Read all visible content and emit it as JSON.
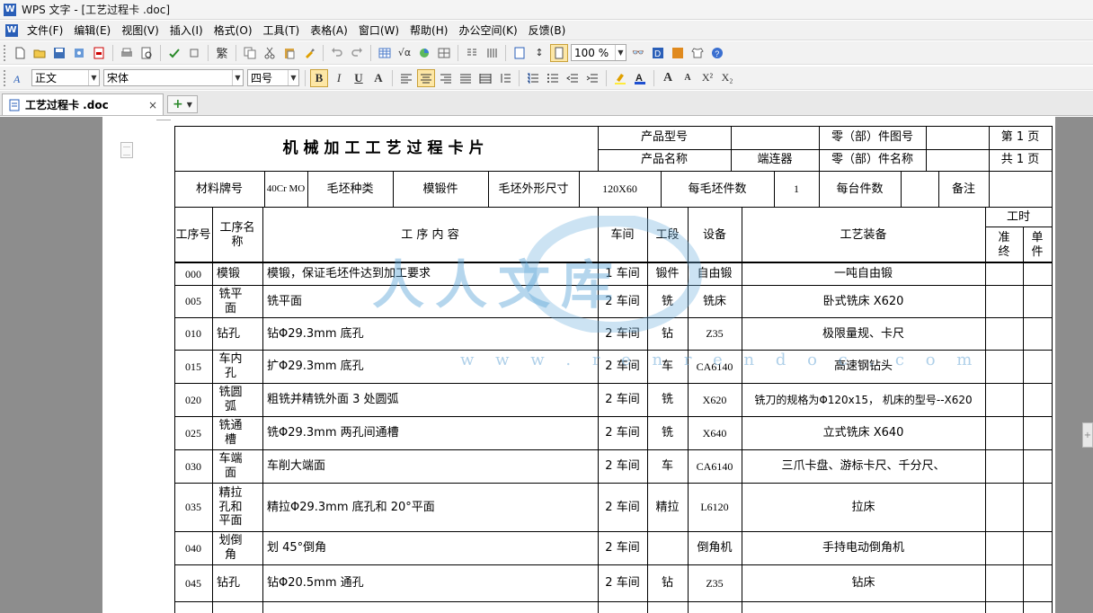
{
  "window": {
    "title": "WPS 文字 - [工艺过程卡 .doc]",
    "app_icon": "W"
  },
  "menu": [
    "文件(F)",
    "编辑(E)",
    "视图(V)",
    "插入(I)",
    "格式(O)",
    "工具(T)",
    "表格(A)",
    "窗口(W)",
    "帮助(H)",
    "办公空间(K)",
    "反馈(B)"
  ],
  "toolbar": {
    "zoom": "100 %",
    "style": "正文",
    "font": "宋体",
    "size": "四号",
    "bold": "B",
    "italic": "I",
    "underline": "U",
    "char_scale": "A",
    "grow": "A",
    "shrink": "A",
    "superscript": "X²",
    "subscript": "X₂"
  },
  "tabs": {
    "doc": "工艺过程卡 .doc",
    "close": "×",
    "new": "+"
  },
  "doc": {
    "title": "机械加工工艺过程卡片",
    "product_model_label": "产品型号",
    "product_model": "",
    "part_no_label": "零（部）件图号",
    "part_no": "",
    "page_no": "第 1 页",
    "product_name_label": "产品名称",
    "product_name": "端连器",
    "part_name_label": "零（部）件名称",
    "part_name": "",
    "total_pages": "共 1 页",
    "material_label": "材料牌号",
    "material": "40Cr MO",
    "blank_type_label": "毛坯种类",
    "blank_type": "模锻件",
    "blank_size_label": "毛坯外形尺寸",
    "blank_size": "120X60",
    "per_blank_label": "每毛坯件数",
    "per_blank": "1",
    "per_unit_label": "每台件数",
    "per_unit": "",
    "remark_label": "备注",
    "remark": "",
    "headers": {
      "no": "工序号",
      "name": "工序名称",
      "content": "工 序 内 容",
      "workshop": "车间",
      "section": "工段",
      "equipment": "设备",
      "tooling": "工艺装备",
      "time": "工时",
      "prep": "准终",
      "unit": "单件"
    },
    "rows": [
      {
        "no": "000",
        "name": "模锻",
        "content": "模锻，保证毛坯件达到加工要求",
        "workshop": "1 车间",
        "section": "锻件",
        "equipment": "自由锻",
        "tooling": "一吨自由锻"
      },
      {
        "no": "005",
        "name": "铣平面",
        "content": "铣平面",
        "workshop": "2 车间",
        "section": "铣",
        "equipment": "铣床",
        "tooling": "卧式铣床 X620"
      },
      {
        "no": "010",
        "name": "钻孔",
        "content": "钻Φ29.3mm 底孔",
        "workshop": "2 车间",
        "section": "钻",
        "equipment": "Z35",
        "tooling": "极限量规、卡尺"
      },
      {
        "no": "015",
        "name": "车内孔",
        "content": "扩Φ29.3mm 底孔",
        "workshop": "2 车间",
        "section": "车",
        "equipment": "CA6140",
        "tooling": "高速钢钻头"
      },
      {
        "no": "020",
        "name": "铣圆弧",
        "content": "粗铣并精铣外面 3 处圆弧",
        "workshop": "2 车间",
        "section": "铣",
        "equipment": "X620",
        "tooling": "铣刀的规格为Φ120x15， 机床的型号--X620"
      },
      {
        "no": "025",
        "name": "铣通槽",
        "content": "铣Φ29.3mm 两孔间通槽",
        "workshop": "2 车间",
        "section": "铣",
        "equipment": "X640",
        "tooling": "立式铣床 X640"
      },
      {
        "no": "030",
        "name": "车端面",
        "content": "车削大端面",
        "workshop": "2 车间",
        "section": "车",
        "equipment": "CA6140",
        "tooling": "三爪卡盘、游标卡尺、千分尺、"
      },
      {
        "no": "035",
        "name": "精拉孔和平面",
        "content": "精拉Φ29.3mm 底孔和 20°平面",
        "workshop": "2 车间",
        "section": "精拉",
        "equipment": "L6120",
        "tooling": "拉床"
      },
      {
        "no": "040",
        "name": "划倒角",
        "content": "划 45°倒角",
        "workshop": "2 车间",
        "section": "",
        "equipment": "倒角机",
        "tooling": "手持电动倒角机"
      },
      {
        "no": "045",
        "name": "钻孔",
        "content": "钻Φ20.5mm 通孔",
        "workshop": "2 车间",
        "section": "钻",
        "equipment": "Z35",
        "tooling": "钻床"
      }
    ]
  },
  "watermark": {
    "text": "人人文库",
    "url": "w w w . r e n r e n d o c . c o m"
  },
  "colors": {
    "workspace": "#8d8d8d",
    "watermark": "#5aa5d7",
    "active_button": "#fde7a6"
  },
  "icons": [
    "new-icon",
    "open-icon",
    "save-icon",
    "permission-icon",
    "pdf-icon",
    "print-icon",
    "preview-icon",
    "spellcheck-icon",
    "format-painter-icon",
    "traditional-icon",
    "copy-icon",
    "cut-icon",
    "paste-icon",
    "brush-icon",
    "undo-icon",
    "redo-icon",
    "table-icon",
    "formula-icon",
    "chart-icon",
    "columns-icon",
    "gear-icon",
    "help-icon"
  ]
}
